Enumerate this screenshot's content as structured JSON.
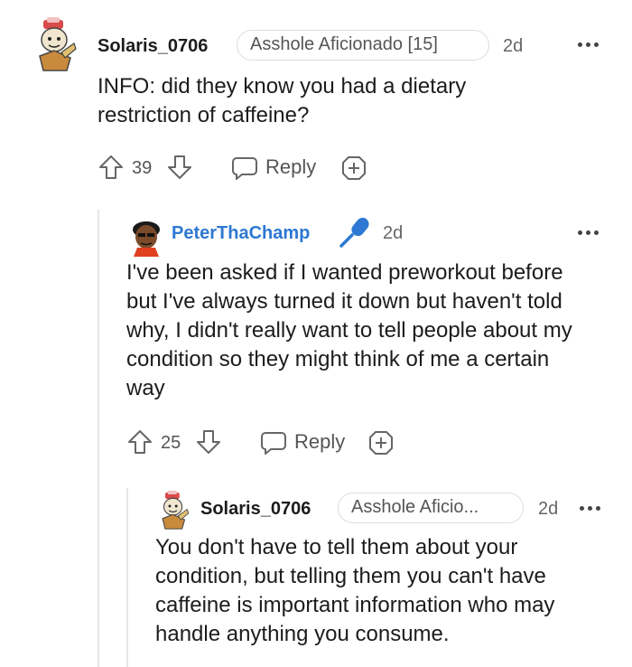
{
  "comments": [
    {
      "username": "Solaris_0706",
      "flair": "Asshole Aficionado [15]",
      "age": "2d",
      "body": "INFO: did they know you had a dietary restriction of caffeine?",
      "votes": "39",
      "reply_label": "Reply"
    },
    {
      "username": "PeterThaChamp",
      "age": "2d",
      "body": "I've been asked if I wanted preworkout before but I've always turned it down but haven't told why, I didn't really want to tell people about my condition so they might think of me a certain way",
      "votes": "25",
      "reply_label": "Reply"
    },
    {
      "username": "Solaris_0706",
      "flair": "Asshole Aficio...",
      "age": "2d",
      "body": "You don't have to tell them about your condition, but telling them you can't have caffeine is important information who may handle anything you consume."
    }
  ],
  "icons": {
    "upvote": "arrow-up-icon",
    "downvote": "arrow-down-icon",
    "reply": "speech-bubble-icon",
    "award": "award-icon",
    "more": "more-dots-icon",
    "mic": "microphone-icon"
  },
  "colors": {
    "username_highlight": "#2d78d3",
    "thread_line": "#e6e6e6"
  }
}
